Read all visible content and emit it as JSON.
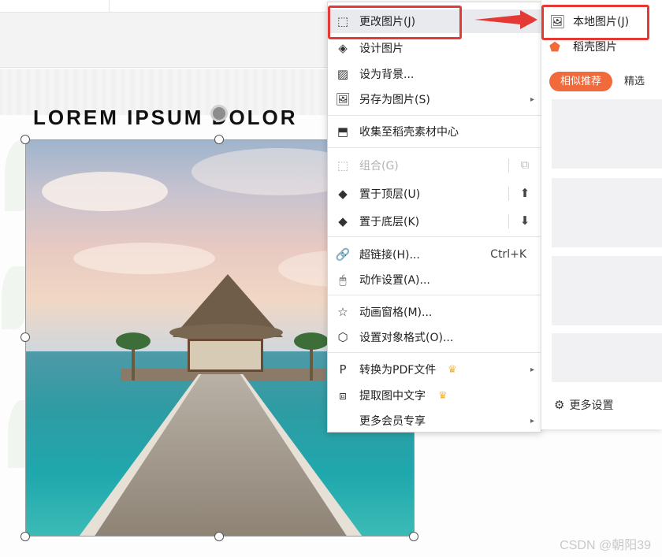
{
  "slide": {
    "title": "LOREM IPSUM DOLOR"
  },
  "context_menu": {
    "items": [
      {
        "label": "更改图片(J)",
        "icon": "change-image-icon",
        "submenu": true
      },
      {
        "label": "设计图片",
        "icon": "design-image-icon"
      },
      {
        "label": "设为背景...",
        "icon": "set-background-icon"
      },
      {
        "label": "另存为图片(S)",
        "icon": "save-as-image-icon",
        "submenu": true
      },
      {
        "label": "收集至稻壳素材中心",
        "icon": "collect-icon"
      },
      {
        "label": "组合(G)",
        "icon": "group-icon",
        "disabled": true
      },
      {
        "label": "置于顶层(U)",
        "icon": "bring-to-front-icon"
      },
      {
        "label": "置于底层(K)",
        "icon": "send-to-back-icon"
      },
      {
        "label": "超链接(H)...",
        "icon": "hyperlink-icon",
        "shortcut": "Ctrl+K"
      },
      {
        "label": "动作设置(A)...",
        "icon": "mouse-icon"
      },
      {
        "label": "动画窗格(M)...",
        "icon": "animation-star-icon"
      },
      {
        "label": "设置对象格式(O)...",
        "icon": "format-object-icon"
      },
      {
        "label": "转换为PDF文件",
        "icon": "pdf-icon",
        "submenu": true,
        "vip": true
      },
      {
        "label": "提取图中文字",
        "icon": "extract-text-icon",
        "vip": true
      },
      {
        "label": "更多会员专享",
        "submenu": true
      }
    ]
  },
  "submenu": {
    "items": [
      {
        "label": "本地图片(J)",
        "icon": "local-image-icon"
      },
      {
        "label": "稻壳图片",
        "icon": "docer-icon"
      }
    ],
    "tabs": [
      "相似推荐",
      "精选"
    ],
    "more_settings": "更多设置"
  },
  "watermark": "CSDN @朝阳39",
  "colors": {
    "accent": "#f06a3c",
    "highlight_box": "#e53935",
    "menu_hover": "#e9eaee"
  }
}
